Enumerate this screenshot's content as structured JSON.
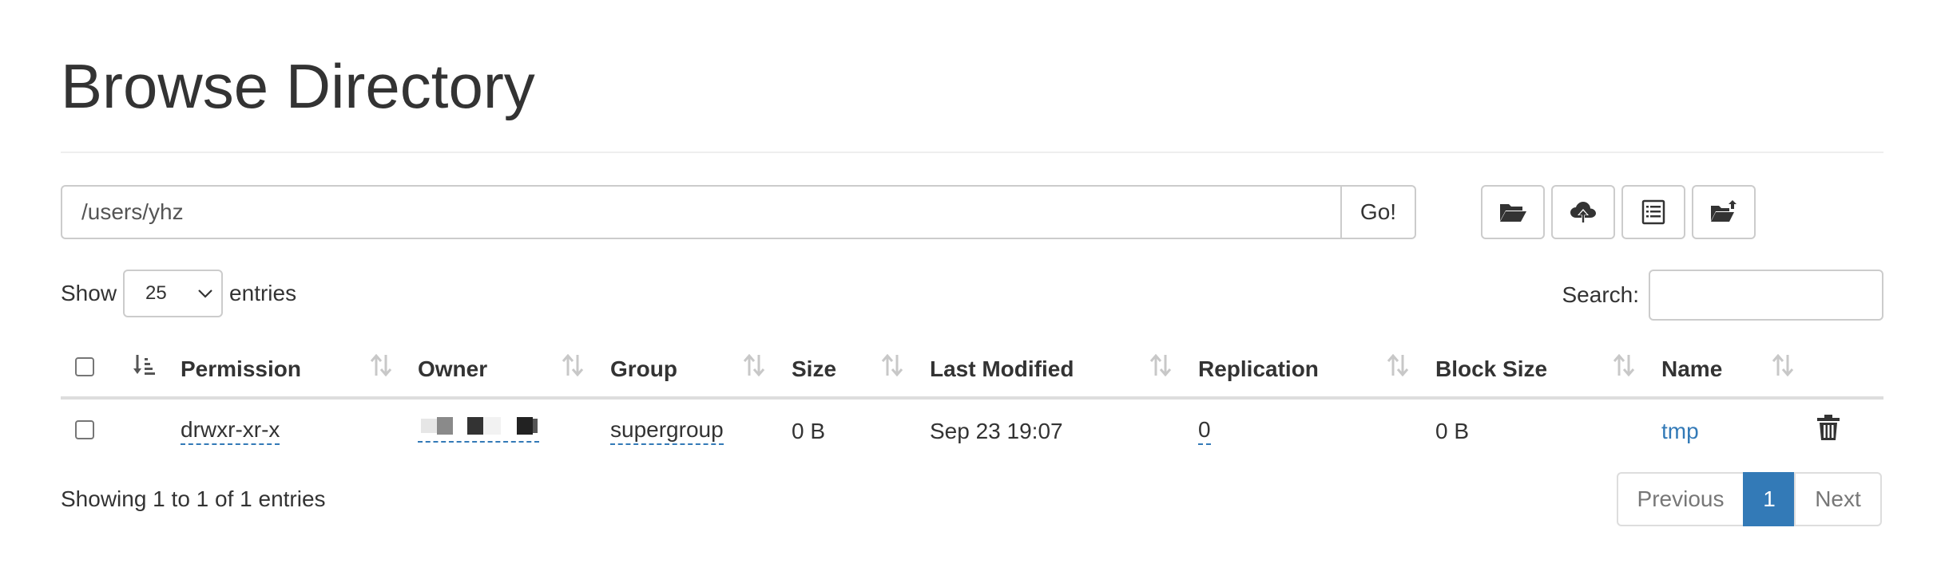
{
  "page": {
    "title": "Browse Directory"
  },
  "path_bar": {
    "value": "/users/yhz",
    "go_label": "Go!"
  },
  "toolbar": {
    "buttons": [
      {
        "name": "create-directory",
        "icon": "folder-open-icon"
      },
      {
        "name": "upload",
        "icon": "cloud-upload-icon"
      },
      {
        "name": "cut-paste",
        "icon": "list-alt-icon"
      },
      {
        "name": "move",
        "icon": "folder-move-icon"
      }
    ]
  },
  "controls": {
    "show_label": "Show",
    "entries_label": "entries",
    "page_length": "25",
    "search_label": "Search:",
    "search_value": ""
  },
  "table": {
    "columns": [
      "Permission",
      "Owner",
      "Group",
      "Size",
      "Last Modified",
      "Replication",
      "Block Size",
      "Name"
    ],
    "rows": [
      {
        "permission": "drwxr-xr-x",
        "owner": "",
        "group": "supergroup",
        "size": "0 B",
        "last_modified": "Sep 23 19:07",
        "replication": "0",
        "block_size": "0 B",
        "name": "tmp",
        "delete_icon": "trash-icon"
      }
    ]
  },
  "footer": {
    "info": "Showing 1 to 1 of 1 entries",
    "pagination": {
      "previous": "Previous",
      "current": "1",
      "next": "Next"
    }
  },
  "colors": {
    "link": "#337ab7",
    "active_page": "#337ab7",
    "border": "#cccccc",
    "text": "#333333"
  }
}
